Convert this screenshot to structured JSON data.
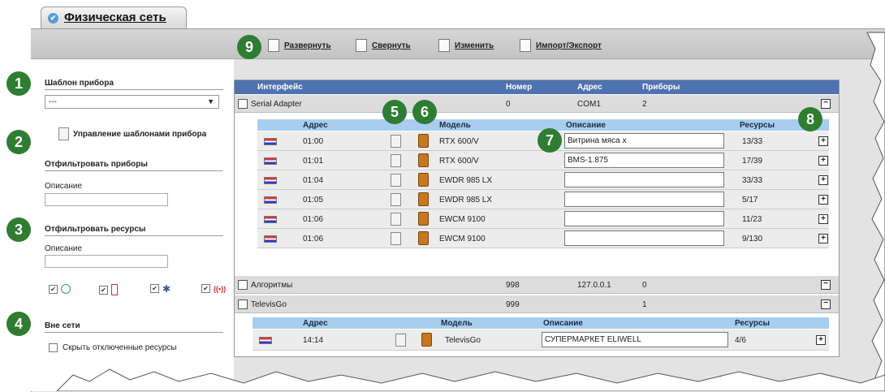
{
  "tab": {
    "title": "Физическая сеть"
  },
  "toolbar": {
    "expand": "Развернуть",
    "collapse": "Свернуть",
    "edit": "Изменить",
    "import_export": "Импорт/Экспорт"
  },
  "badges": [
    "1",
    "2",
    "3",
    "4",
    "5",
    "6",
    "7",
    "8",
    "9"
  ],
  "side": {
    "template_title": "Шаблон прибора",
    "template_value": "---",
    "manage_templates": "Управление шаблонами прибора",
    "filter_devices_title": "Отфильтровать приборы",
    "filter_devices_label": "Описание",
    "filter_resources_title": "Отфильтровать ресурсы",
    "filter_resources_label": "Описание",
    "offline_title": "Вне сети",
    "hide_disabled": "Скрыть отключенные ресурсы"
  },
  "table": {
    "headers": [
      "Интерфейс",
      "Номер",
      "Адрес",
      "Приборы"
    ],
    "sub_headers": [
      "Адрес",
      "Модель",
      "Описание",
      "Ресурсы"
    ],
    "groups": [
      {
        "name": "Serial Adapter",
        "number": "0",
        "address": "COM1",
        "devices": "2"
      },
      {
        "name": "Алгоритмы",
        "number": "998",
        "address": "127.0.0.1",
        "devices": "0"
      },
      {
        "name": "TelevisGo",
        "number": "999",
        "address": "",
        "devices": "1"
      }
    ],
    "serial_rows": [
      {
        "address": "01:00",
        "model": "RTX 600/V",
        "description": "Витрина мяса x",
        "resources": "13/33"
      },
      {
        "address": "01:01",
        "model": "RTX 600/V",
        "description": "BMS-1.875",
        "resources": "17/39"
      },
      {
        "address": "01:04",
        "model": "EWDR 985 LX",
        "description": "",
        "resources": "33/33"
      },
      {
        "address": "01:05",
        "model": "EWDR 985 LX",
        "description": "",
        "resources": "5/17"
      },
      {
        "address": "01:06",
        "model": "EWCM 9100",
        "description": "",
        "resources": "11/23"
      },
      {
        "address": "01:06",
        "model": "EWCM 9100",
        "description": "",
        "resources": "9/130"
      }
    ],
    "televis_rows": [
      {
        "address": "14:14",
        "model": "TelevisGo",
        "description": "СУПЕРМАРКЕТ ELIWELL",
        "resources": "4/6"
      }
    ]
  }
}
